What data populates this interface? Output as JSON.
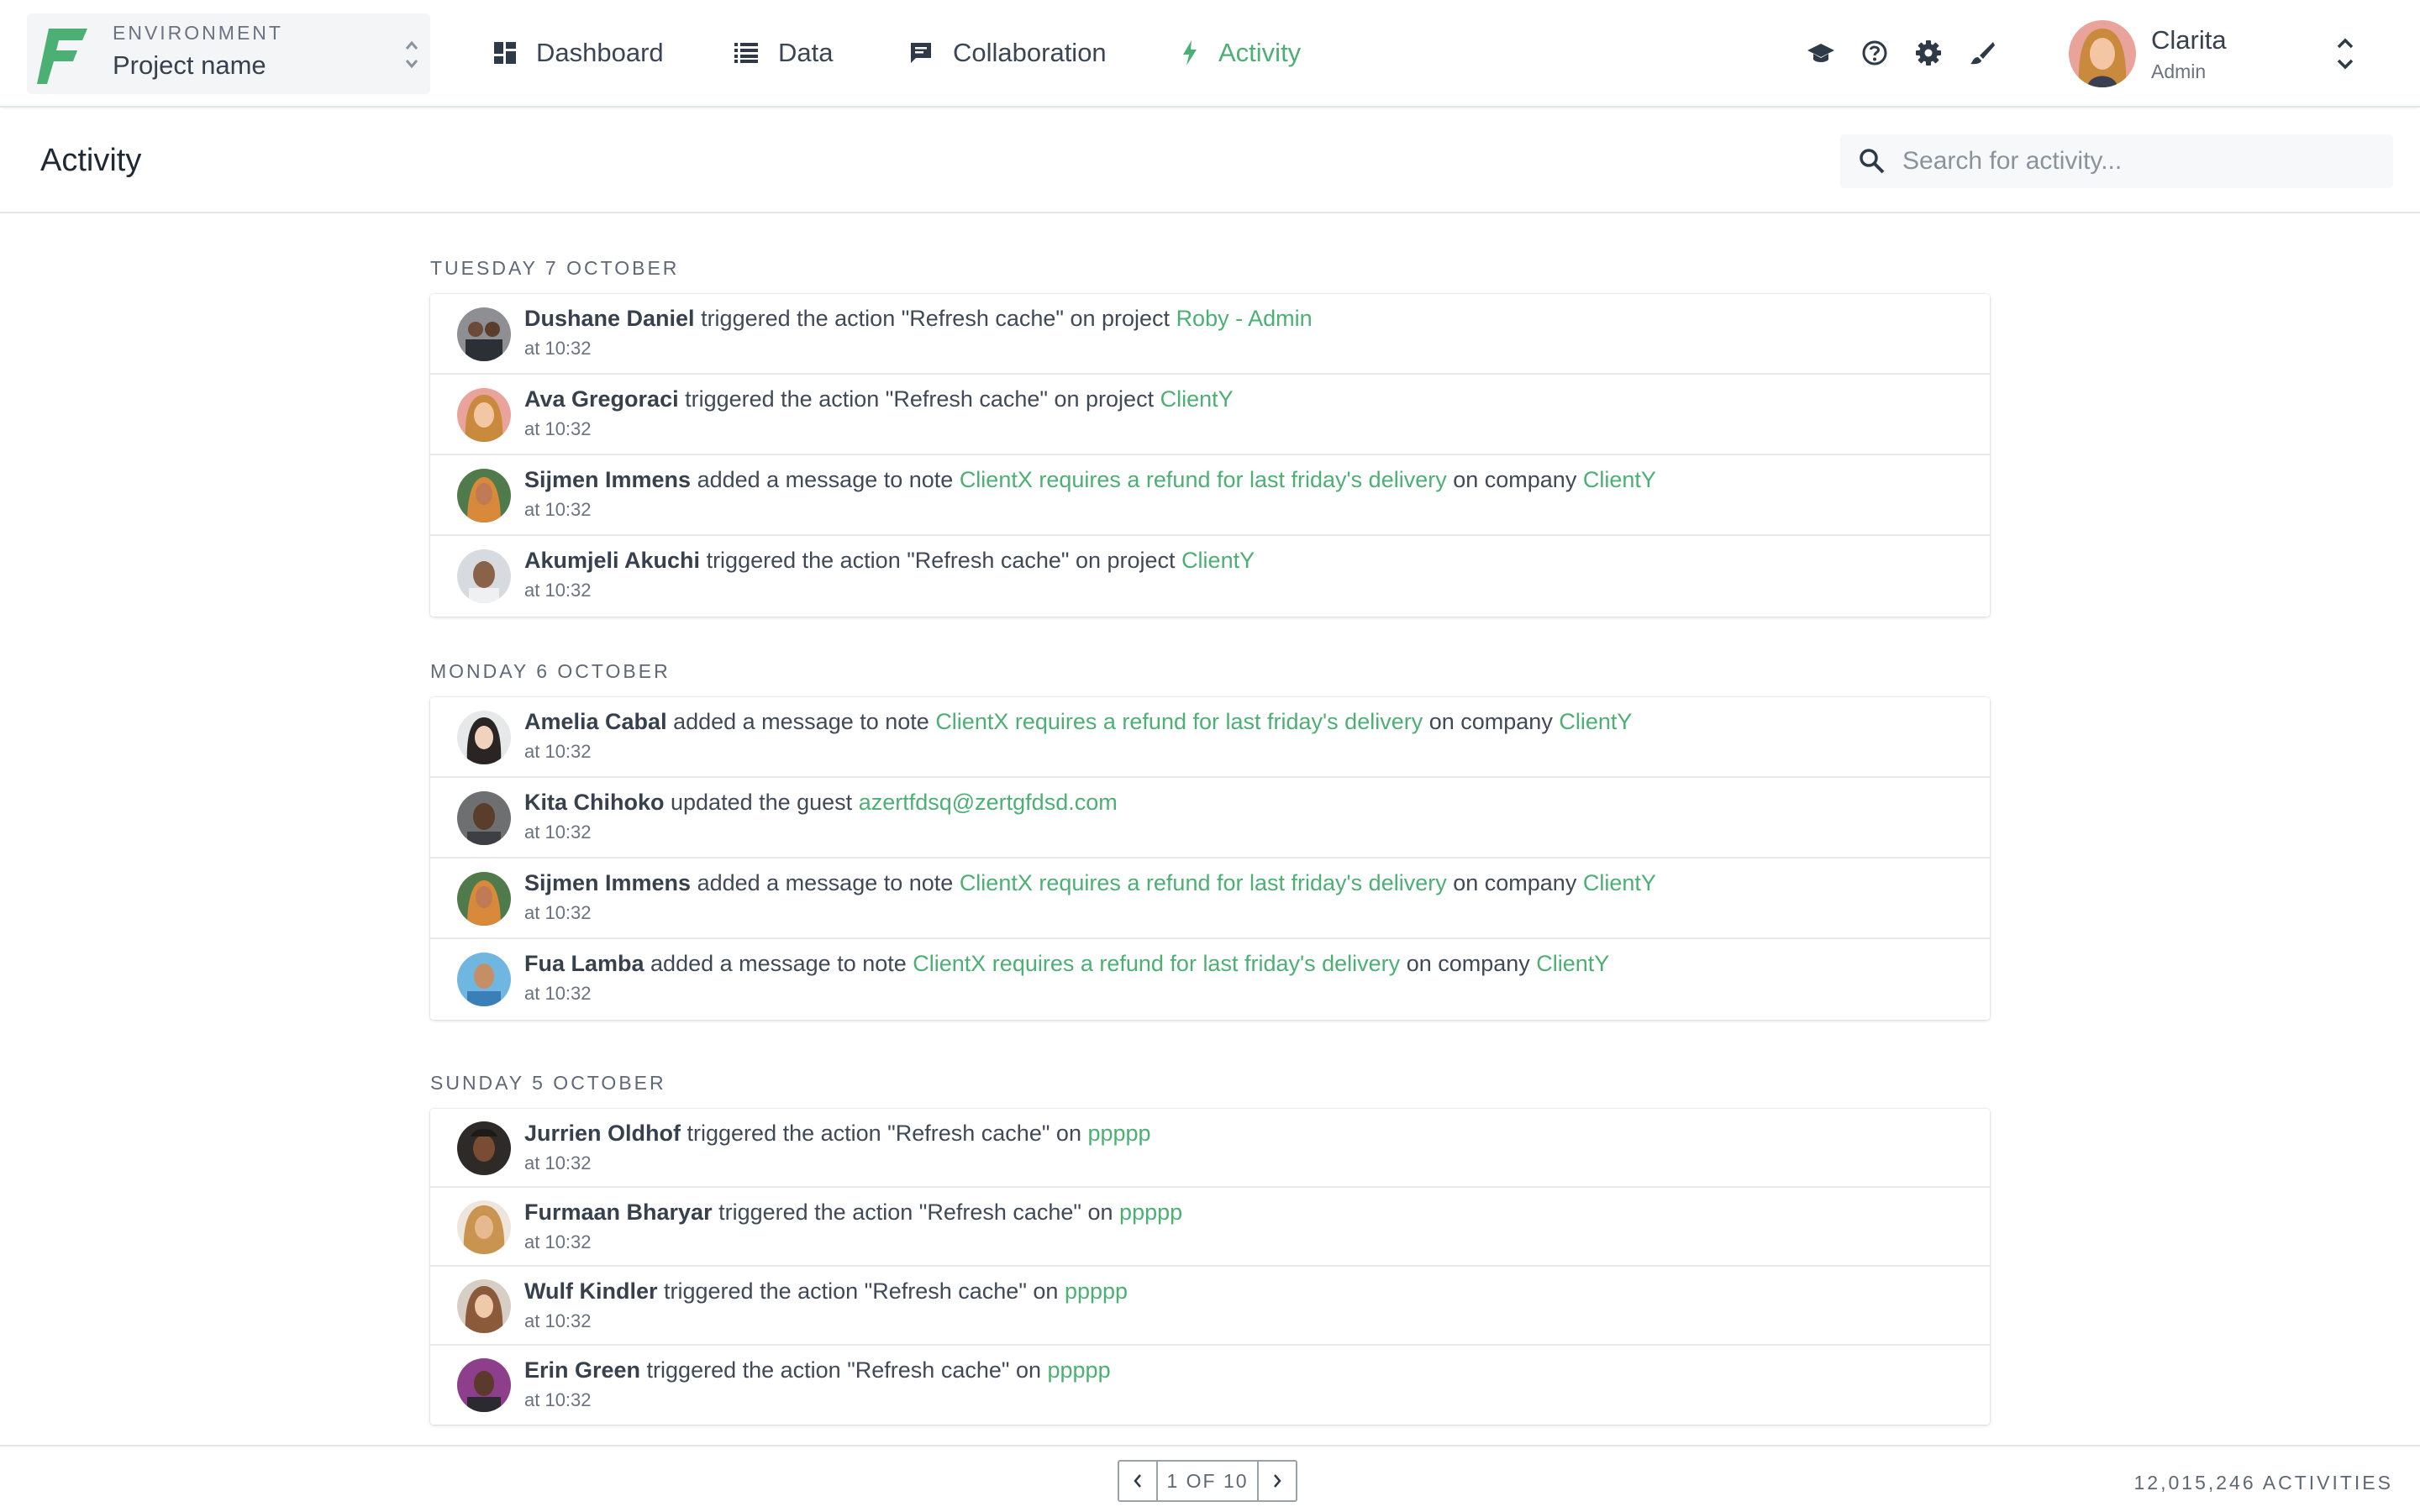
{
  "environment": {
    "label": "ENVIRONMENT",
    "project_name": "Project name"
  },
  "nav": [
    {
      "label": "Dashboard",
      "icon": "dashboard-icon"
    },
    {
      "label": "Data",
      "icon": "list-icon"
    },
    {
      "label": "Collaboration",
      "icon": "chat-icon"
    },
    {
      "label": "Activity",
      "icon": "bolt-icon",
      "active": true
    }
  ],
  "tools": [
    "graduation-cap-icon",
    "help-icon",
    "gear-icon",
    "brush-icon"
  ],
  "user": {
    "name": "Clarita",
    "role": "Admin"
  },
  "page": {
    "title": "Activity"
  },
  "search": {
    "placeholder": "Search for activity..."
  },
  "colors": {
    "accent": "#4caf74",
    "text": "#3a4452"
  },
  "days": [
    {
      "label": "TUESDAY 7 OCTOBER",
      "items": [
        {
          "user": "Dushane Daniel",
          "parts": [
            " triggered the action \"Refresh cache\" on project "
          ],
          "links": [
            "Roby - Admin"
          ],
          "time": "at 10:32"
        },
        {
          "user": "Ava Gregoraci",
          "parts": [
            " triggered the action \"Refresh cache\" on project "
          ],
          "links": [
            "ClientY"
          ],
          "time": "at 10:32"
        },
        {
          "user": "Sijmen Immens",
          "parts": [
            "  added a message to note ",
            " on  company "
          ],
          "links": [
            "ClientX requires a refund for last friday's delivery",
            "ClientY"
          ],
          "time": "at 10:32"
        },
        {
          "user": "Akumjeli Akuchi",
          "parts": [
            " triggered the action \"Refresh cache\" on project "
          ],
          "links": [
            "ClientY"
          ],
          "time": "at 10:32"
        }
      ]
    },
    {
      "label": "MONDAY 6 OCTOBER",
      "items": [
        {
          "user": "Amelia Cabal",
          "parts": [
            "  added a message to note ",
            "  on  company "
          ],
          "links": [
            "ClientX requires a refund for last friday's delivery",
            "ClientY"
          ],
          "time": "at 10:32"
        },
        {
          "user": "Kita Chihoko",
          "parts": [
            " updated the guest "
          ],
          "links": [
            "azertfdsq@zertgfdsd.com"
          ],
          "time": "at 10:32"
        },
        {
          "user": "Sijmen Immens",
          "parts": [
            "  added a message to note ",
            " on  company "
          ],
          "links": [
            "ClientX requires a refund for last friday's delivery",
            "ClientY"
          ],
          "time": "at 10:32"
        },
        {
          "user": "Fua Lamba",
          "parts": [
            "  added a message to note ",
            " on  company "
          ],
          "links": [
            "ClientX requires a refund for last friday's delivery",
            "ClientY"
          ],
          "time": "at 10:32"
        }
      ]
    },
    {
      "label": "SUNDAY 5 OCTOBER",
      "items": [
        {
          "user": "Jurrien Oldhof",
          "parts": [
            " triggered the action \"Refresh cache\" on "
          ],
          "links": [
            "ppppp"
          ],
          "time": "at 10:32"
        },
        {
          "user": "Furmaan Bharyar",
          "parts": [
            " triggered the action \"Refresh cache\" on "
          ],
          "links": [
            "ppppp"
          ],
          "time": "at 10:32"
        },
        {
          "user": "Wulf Kindler",
          "parts": [
            " triggered the action \"Refresh cache\" on "
          ],
          "links": [
            "ppppp"
          ],
          "time": "at 10:32"
        },
        {
          "user": "Erin Green",
          "parts": [
            " triggered the action \"Refresh cache\" on "
          ],
          "links": [
            "ppppp"
          ],
          "time": "at 10:32"
        }
      ]
    }
  ],
  "pagination": {
    "info": "1 OF 10",
    "total": "12,015,246 ACTIVITIES"
  }
}
